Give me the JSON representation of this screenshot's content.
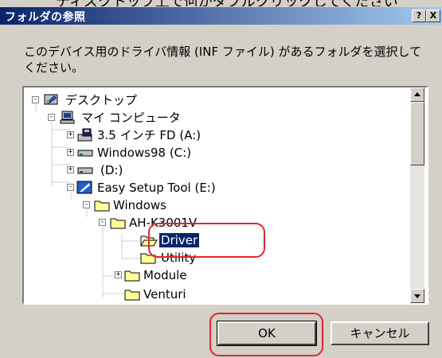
{
  "caption_fragment": "ディスクトップ上で何かダブルクリックしてください",
  "window": {
    "title": "フォルダの参照",
    "help_label": "?",
    "close_label": "X"
  },
  "instruction": "このデバイス用のドライバ情報 (INF ファイル) があるフォルダを選択してください。",
  "tree": [
    {
      "label": "デスクトップ",
      "icon": "desktop-icon",
      "expander": "-"
    },
    {
      "label": "マイ コンピュータ",
      "icon": "my-computer-icon",
      "expander": "-"
    },
    {
      "label": "3.5 インチ FD (A:)",
      "icon": "floppy-drive-icon",
      "expander": "+"
    },
    {
      "label": "Windows98 (C:)",
      "icon": "hard-drive-icon",
      "expander": "+"
    },
    {
      "label": "(D:)",
      "icon": "hard-drive-icon",
      "expander": "+"
    },
    {
      "label": "Easy Setup Tool (E:)",
      "icon": "cd-drive-icon",
      "expander": "-"
    },
    {
      "label": "Windows",
      "icon": "folder-icon",
      "expander": "-"
    },
    {
      "label": "AH-K3001V",
      "icon": "folder-icon",
      "expander": "-"
    },
    {
      "label": "Driver",
      "icon": "open-folder-icon",
      "expander": "",
      "selected": true
    },
    {
      "label": "Utility",
      "icon": "folder-icon",
      "expander": ""
    },
    {
      "label": "Module",
      "icon": "folder-icon",
      "expander": "+"
    },
    {
      "label": "Venturi",
      "icon": "folder-icon",
      "expander": ""
    }
  ],
  "buttons": {
    "ok": "OK",
    "cancel": "キャンセル"
  },
  "colors": {
    "titlebar_start": "#0a246a",
    "titlebar_end": "#a6caf0",
    "selection": "#0a246a",
    "annotation": "#e0262b"
  }
}
